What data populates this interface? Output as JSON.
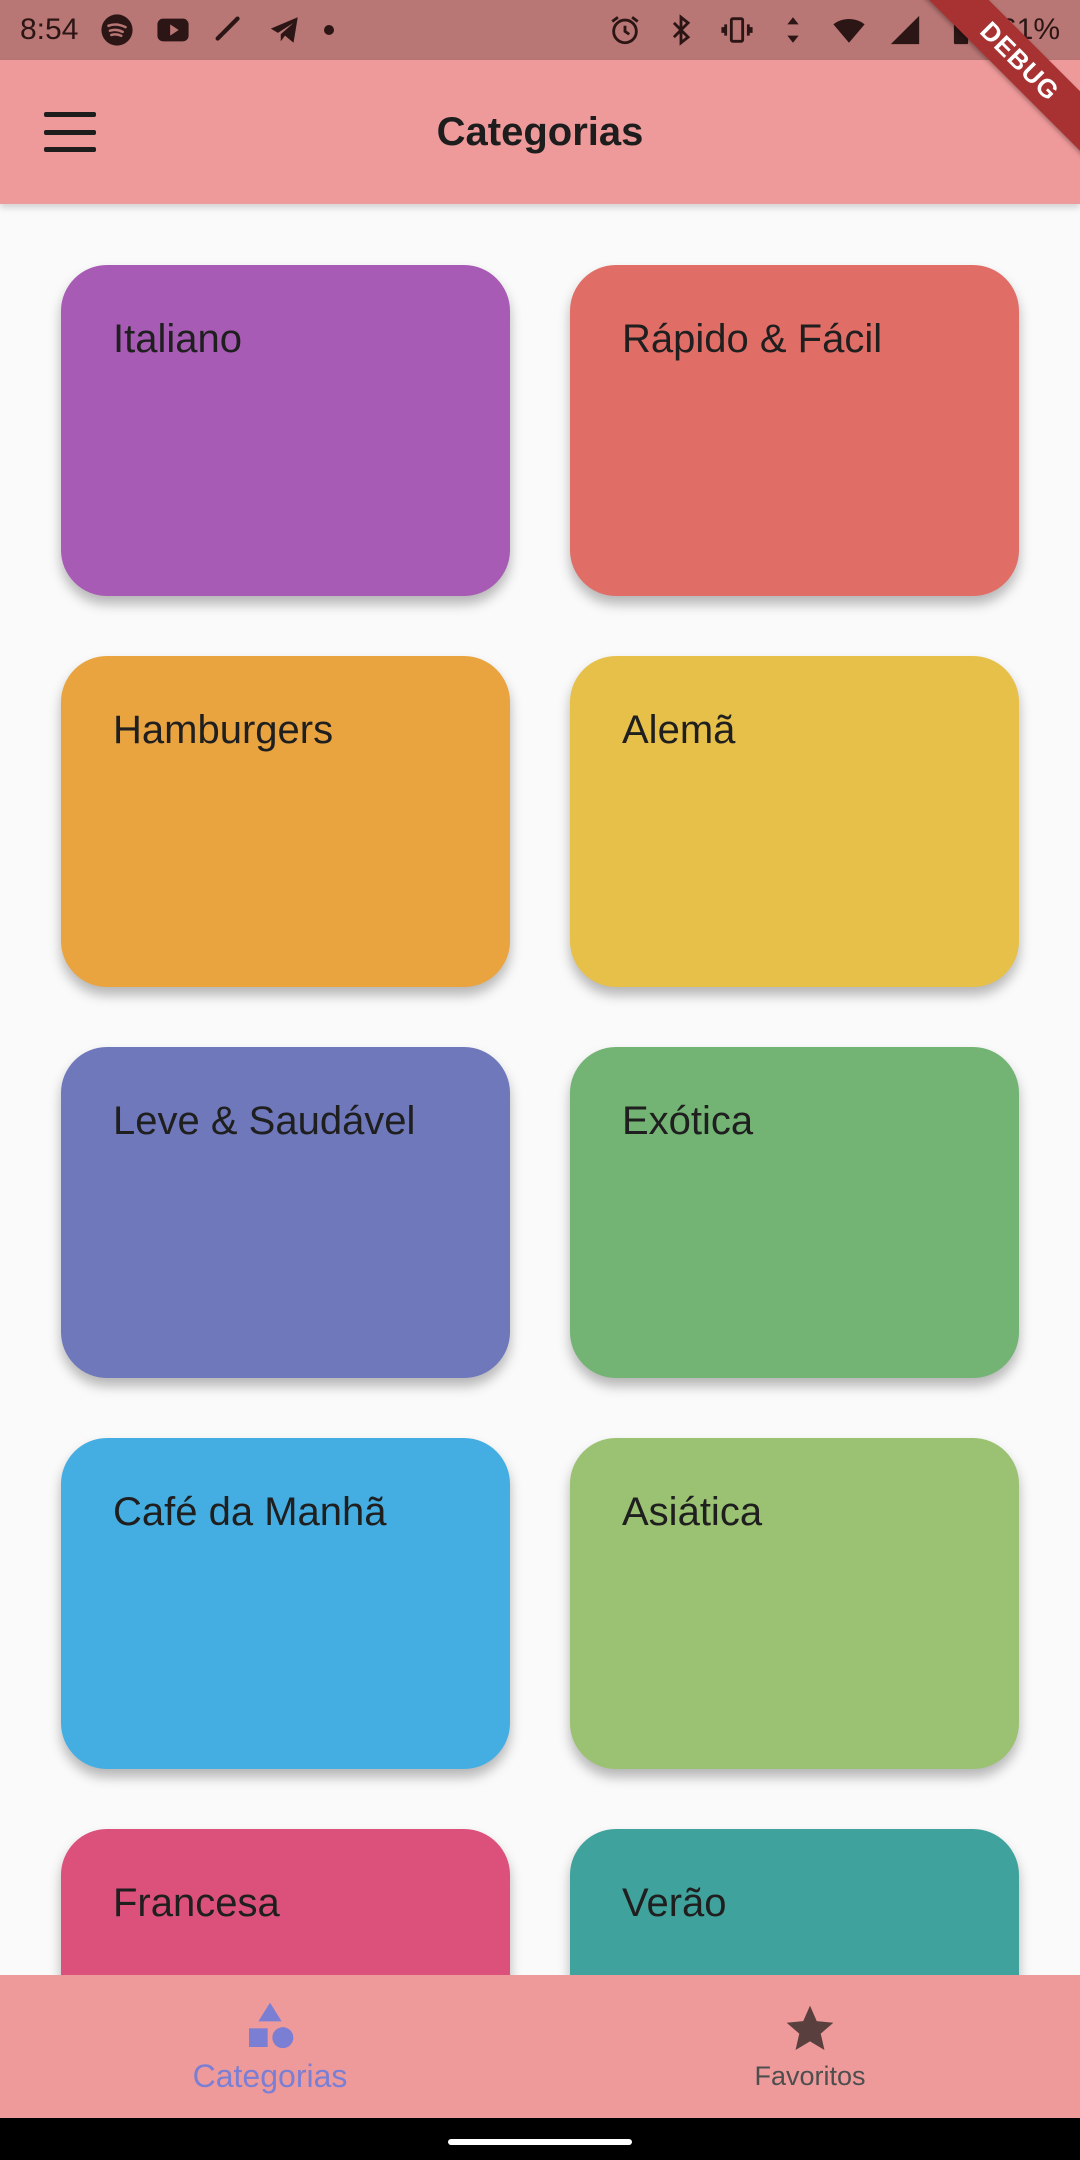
{
  "status_bar": {
    "time": "8:54",
    "battery": "61%"
  },
  "debug_label": "DEBUG",
  "app_bar": {
    "title": "Categorias"
  },
  "categories": [
    {
      "label": "Italiano",
      "color": "#a75bb4"
    },
    {
      "label": "Rápido & Fácil",
      "color": "#e06d66"
    },
    {
      "label": "Hamburgers",
      "color": "#e9a440"
    },
    {
      "label": "Alemã",
      "color": "#e6c048"
    },
    {
      "label": "Leve & Saudável",
      "color": "#6e78ba"
    },
    {
      "label": "Exótica",
      "color": "#73b475"
    },
    {
      "label": "Café da Manhã",
      "color": "#44aee2"
    },
    {
      "label": "Asiática",
      "color": "#9bc272"
    },
    {
      "label": "Francesa",
      "color": "#dc507c"
    },
    {
      "label": "Verão",
      "color": "#40a29c"
    }
  ],
  "bottom_nav": {
    "categories_label": "Categorias",
    "favorites_label": "Favoritos",
    "active_color": "#7b7fd4"
  }
}
